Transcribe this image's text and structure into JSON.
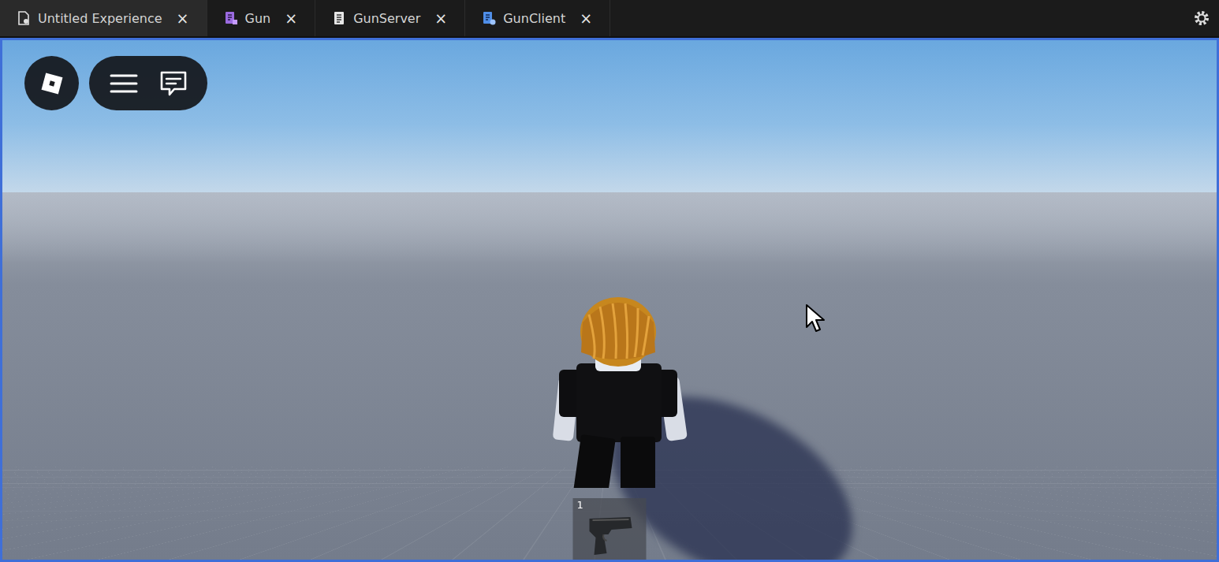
{
  "tabs": [
    {
      "label": "Untitled Experience",
      "selected": true,
      "kind": "place",
      "close": "×"
    },
    {
      "label": "Gun",
      "selected": false,
      "kind": "module",
      "close": "×"
    },
    {
      "label": "GunServer",
      "selected": false,
      "kind": "script",
      "close": "×"
    },
    {
      "label": "GunClient",
      "selected": false,
      "kind": "localscript",
      "close": "×"
    }
  ],
  "hotbar": {
    "slots": [
      {
        "number": "1",
        "selected": false
      }
    ]
  }
}
